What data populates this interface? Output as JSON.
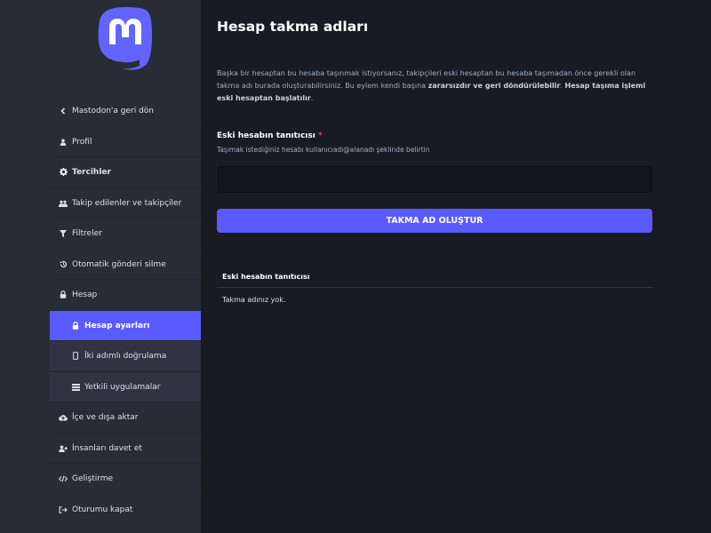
{
  "sidebar": {
    "back": "Mastodon'a geri dön",
    "items": [
      {
        "label": "Profil"
      },
      {
        "label": "Tercihler"
      },
      {
        "label": "Takip edilenler ve takipçiler"
      },
      {
        "label": "Filtreler"
      },
      {
        "label": "Otomatik gönderi silme"
      },
      {
        "label": "Hesap"
      },
      {
        "label": "Hesap ayarları"
      },
      {
        "label": "İki adımlı doğrulama"
      },
      {
        "label": "Yetkili uygulamalar"
      },
      {
        "label": "İçe ve dışa aktar"
      },
      {
        "label": "İnsanları davet et"
      },
      {
        "label": "Geliştirme"
      },
      {
        "label": "Oturumu kapat"
      }
    ]
  },
  "main": {
    "title": "Hesap takma adları",
    "intro_text": "Başka bir hesaptan bu hesaba taşınmak istiyorsanız, takipçileri eski hesaptan bu hesaba taşımadan önce gerekli olan takma adı burada oluşturabilirsiniz. Bu eylem kendi başına ",
    "intro_bold1": "zararsızdır ve geri döndürülebilir",
    "intro_mid": ". ",
    "intro_bold2": "Hesap taşıma işlemi eski hesaptan başlatılır",
    "intro_end": ".",
    "field_label": "Eski hesabın tanıtıcısı",
    "field_required_mark": "*",
    "field_hint": "Taşımak istediğiniz hesabı kullanıcıadı@alanadı şeklinde belirtin",
    "field_value": "",
    "submit_label": "TAKMA AD OLUŞTUR",
    "table_header": "Eski hesabın tanıtıcısı",
    "table_empty": "Takma adınız yok."
  },
  "colors": {
    "accent": "#595aff",
    "sidebar_bg": "#282c37",
    "page_bg": "#191b22",
    "required": "#df405a"
  },
  "icons": [
    "mastodon-logo",
    "chevron-left-icon",
    "user-icon",
    "gear-icon",
    "users-icon",
    "filter-icon",
    "history-icon",
    "lock-icon",
    "mobile-icon",
    "list-icon",
    "cloud-upload-icon",
    "user-plus-icon",
    "code-icon",
    "sign-out-icon"
  ]
}
